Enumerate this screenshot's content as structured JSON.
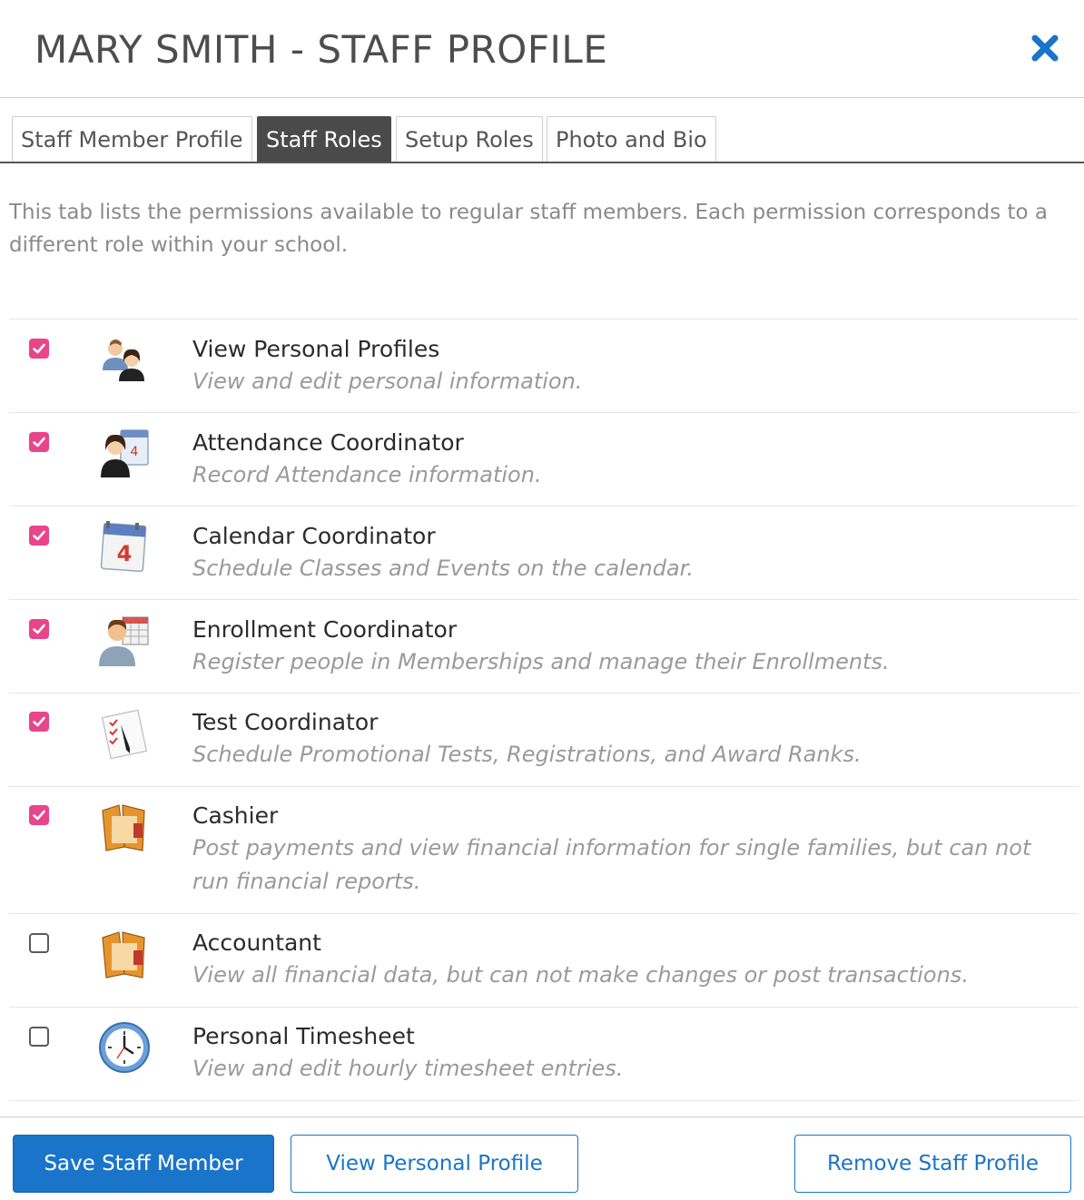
{
  "dialog": {
    "title": "MARY SMITH - STAFF PROFILE",
    "close_icon": "close-x-icon",
    "accent_color": "#1a74c9"
  },
  "tabs": [
    {
      "label": "Staff Member Profile",
      "active": false
    },
    {
      "label": "Staff Roles",
      "active": true
    },
    {
      "label": "Setup Roles",
      "active": false
    },
    {
      "label": "Photo and Bio",
      "active": false
    }
  ],
  "intro_text": "This tab lists the permissions available to regular staff members.  Each permission corresponds to a different role within your school.",
  "roles": [
    {
      "title": "View Personal Profiles",
      "description": "View and edit personal information.",
      "checked": true,
      "icon": "people-profiles-icon"
    },
    {
      "title": "Attendance Coordinator",
      "description": "Record Attendance information.",
      "checked": true,
      "icon": "person-calendar-icon"
    },
    {
      "title": "Calendar Coordinator",
      "description": "Schedule Classes and Events on the calendar.",
      "checked": true,
      "icon": "calendar-icon"
    },
    {
      "title": "Enrollment Coordinator",
      "description": "Register people in Memberships and manage their Enrollments.",
      "checked": true,
      "icon": "person-grid-icon"
    },
    {
      "title": "Test Coordinator",
      "description": "Schedule Promotional Tests, Registrations, and Award Ranks.",
      "checked": true,
      "icon": "checklist-pen-icon"
    },
    {
      "title": "Cashier",
      "description": "Post payments and view financial information for single families, but can not run financial reports.",
      "checked": true,
      "icon": "wallet-icon"
    },
    {
      "title": "Accountant",
      "description": "View all financial data, but can not make changes or post transactions.",
      "checked": false,
      "icon": "wallet-icon"
    },
    {
      "title": "Personal Timesheet",
      "description": "View and edit hourly timesheet entries.",
      "checked": false,
      "icon": "clock-icon"
    }
  ],
  "checkbox_color": "#e8458b",
  "footer": {
    "save_label": "Save Staff Member",
    "view_label": "View Personal Profile",
    "remove_label": "Remove Staff Profile"
  }
}
